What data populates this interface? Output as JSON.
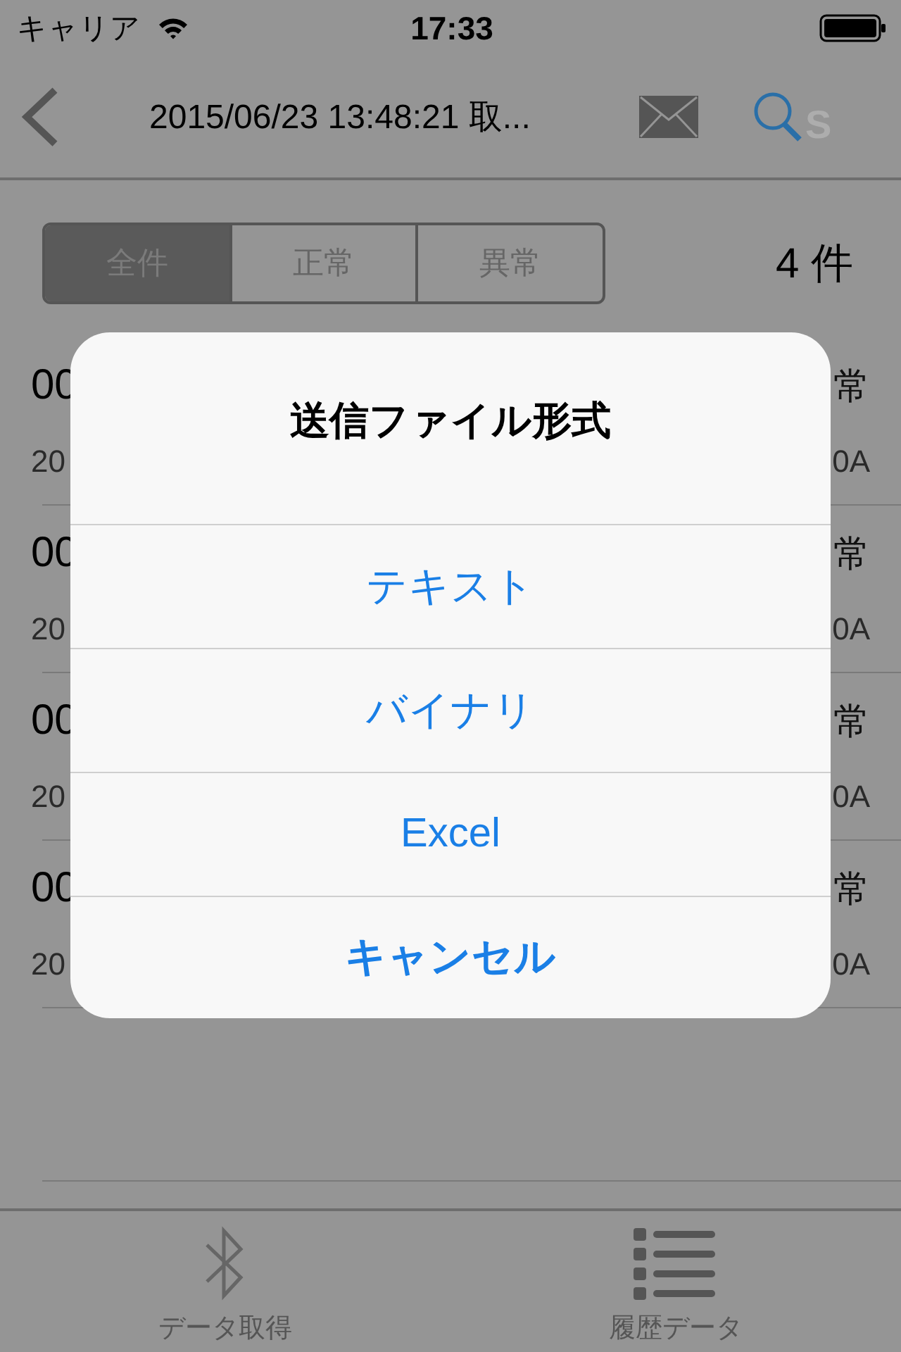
{
  "status_bar": {
    "carrier": "キャリア",
    "time": "17:33"
  },
  "nav": {
    "title": "2015/06/23 13:48:21 取...",
    "ghost_text": "S"
  },
  "segments": [
    {
      "label": "全件",
      "selected": true
    },
    {
      "label": "正常",
      "selected": false
    },
    {
      "label": "異常",
      "selected": false
    }
  ],
  "count": "4 件",
  "rows": [
    {
      "primary": "00",
      "status": "常",
      "secondary": "20",
      "value": "0A"
    },
    {
      "primary": "00",
      "status": "常",
      "secondary": "20",
      "value": "0A"
    },
    {
      "primary": "00",
      "status": "常",
      "secondary": "20",
      "value": "0A"
    },
    {
      "primary": "00",
      "status": "常",
      "secondary": "20",
      "value": "0A"
    }
  ],
  "alert": {
    "title": "送信ファイル形式",
    "actions": [
      {
        "label": "テキスト",
        "kind": "default"
      },
      {
        "label": "バイナリ",
        "kind": "default"
      },
      {
        "label": "Excel",
        "kind": "default"
      },
      {
        "label": "キャンセル",
        "kind": "cancel"
      }
    ]
  },
  "tab_bar": [
    {
      "label": "データ取得",
      "kind": "bluetooth"
    },
    {
      "label": "履歴データ",
      "kind": "list"
    }
  ]
}
